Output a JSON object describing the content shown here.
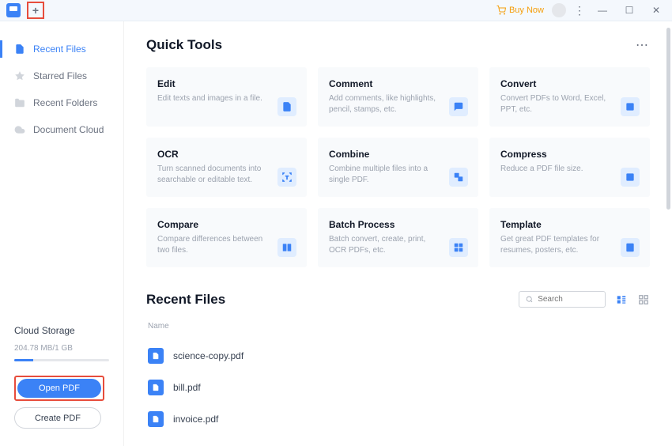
{
  "titlebar": {
    "buy_now": "Buy Now"
  },
  "sidebar": {
    "items": [
      {
        "label": "Recent Files"
      },
      {
        "label": "Starred Files"
      },
      {
        "label": "Recent Folders"
      },
      {
        "label": "Document Cloud"
      }
    ],
    "cloud": {
      "title": "Cloud Storage",
      "usage": "204.78 MB/1 GB"
    },
    "open_pdf": "Open PDF",
    "create_pdf": "Create PDF"
  },
  "quick_tools": {
    "title": "Quick Tools",
    "cards": [
      {
        "title": "Edit",
        "desc": "Edit texts and images in a file."
      },
      {
        "title": "Comment",
        "desc": "Add comments, like highlights, pencil, stamps, etc."
      },
      {
        "title": "Convert",
        "desc": "Convert PDFs to Word, Excel, PPT, etc."
      },
      {
        "title": "OCR",
        "desc": "Turn scanned documents into searchable or editable text."
      },
      {
        "title": "Combine",
        "desc": "Combine multiple files into a single PDF."
      },
      {
        "title": "Compress",
        "desc": "Reduce a PDF file size."
      },
      {
        "title": "Compare",
        "desc": "Compare differences between two files."
      },
      {
        "title": "Batch Process",
        "desc": "Batch convert, create, print, OCR PDFs, etc."
      },
      {
        "title": "Template",
        "desc": "Get great PDF templates for resumes, posters, etc."
      }
    ]
  },
  "recent": {
    "title": "Recent Files",
    "search_placeholder": "Search",
    "name_header": "Name",
    "files": [
      {
        "name": "science-copy.pdf"
      },
      {
        "name": "bill.pdf"
      },
      {
        "name": "invoice.pdf"
      }
    ]
  }
}
